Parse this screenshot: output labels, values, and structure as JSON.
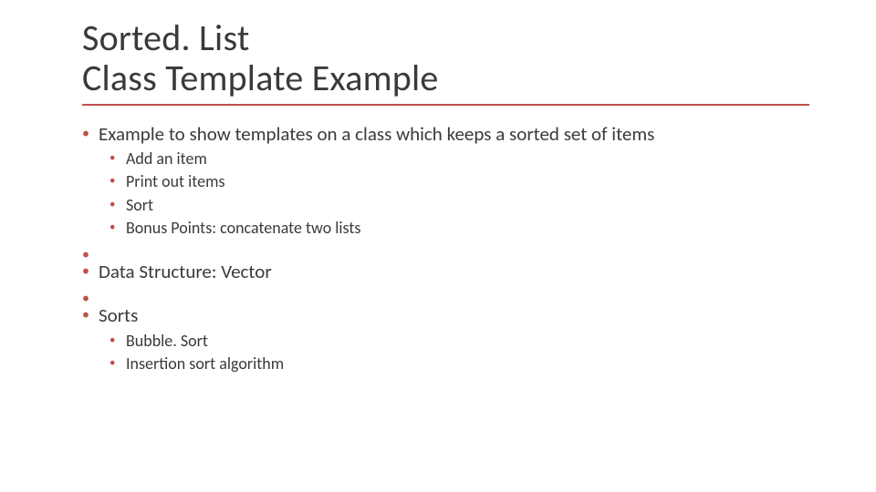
{
  "title": {
    "line1": "Sorted. List",
    "line2": "Class Template Example"
  },
  "accent_color": "#c0504d",
  "bullets": [
    {
      "text": "Example to show templates on a class which keeps a sorted set of items",
      "children": [
        {
          "text": "Add an item"
        },
        {
          "text": "Print out items"
        },
        {
          "text": "Sort"
        },
        {
          "text": "Bonus Points:  concatenate two lists"
        }
      ]
    },
    {
      "text": "Data Structure:  Vector",
      "children": []
    },
    {
      "text": "Sorts",
      "children": [
        {
          "text": "Bubble. Sort"
        },
        {
          "text": "Insertion sort algorithm"
        }
      ]
    }
  ]
}
